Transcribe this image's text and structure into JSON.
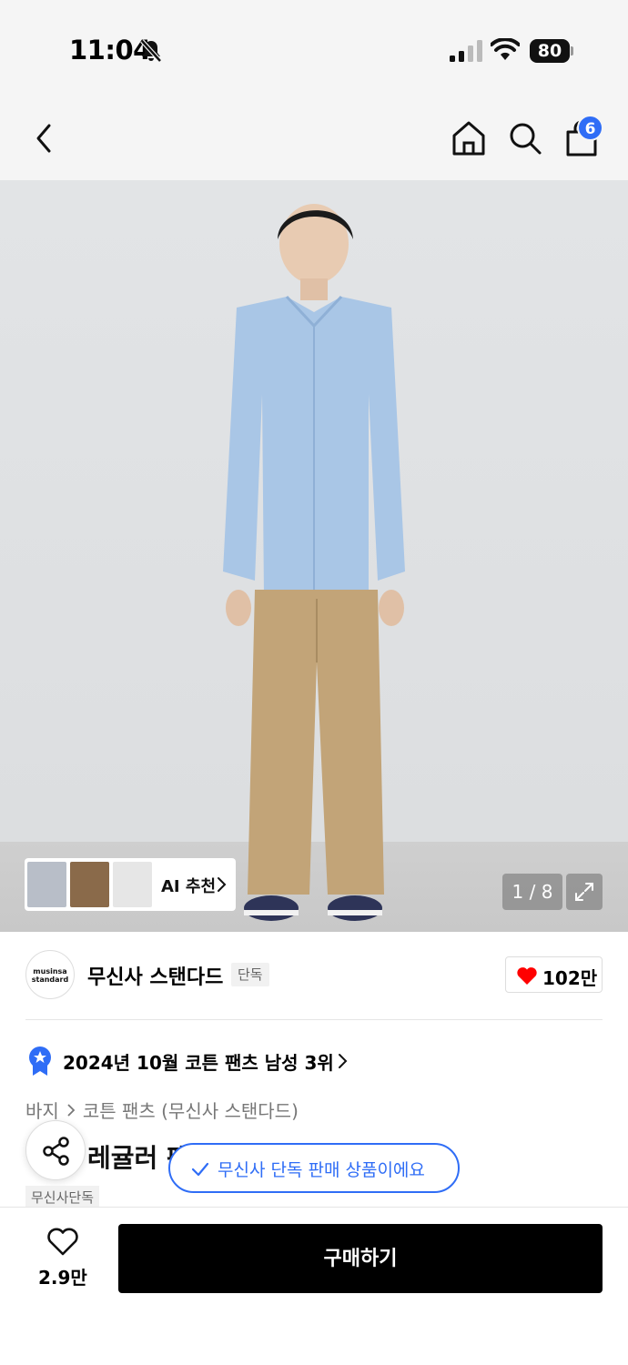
{
  "status_bar": {
    "time": "11:04",
    "battery": "80"
  },
  "nav": {
    "cart_count": "6"
  },
  "gallery": {
    "ai_label": "AI 추천",
    "counter": "1 / 8"
  },
  "brand": {
    "logo_line1": "musinsa",
    "logo_line2": "standard",
    "name": "무신사 스탠다드",
    "tag": "단독",
    "like_count": "102만"
  },
  "ranking": {
    "text": "2024년 10월 코튼 팬츠 남성 3위"
  },
  "breadcrumb": {
    "category": "바지",
    "subcategory": "코튼 팬츠 (무신사 스탠다드)"
  },
  "product": {
    "title_visible": "레귤러 팬"
  },
  "toast": {
    "text": "무신사 단독 판매 상품이에요"
  },
  "tag": {
    "label": "무신사단독"
  },
  "bottom": {
    "wish_count": "2.9만",
    "buy_label": "구매하기"
  },
  "colors": {
    "accent_blue": "#2f6df6",
    "heart_red": "#ff0000"
  }
}
